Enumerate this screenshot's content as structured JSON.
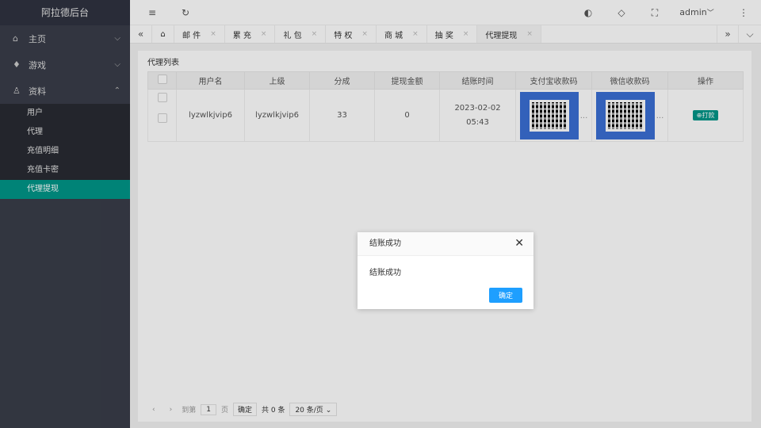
{
  "sidebar": {
    "title": "阿拉德后台",
    "menus": [
      {
        "icon": "⌂",
        "label": "主页",
        "chevron": "⌵"
      },
      {
        "icon": "♦",
        "label": "游戏",
        "chevron": "⌵"
      },
      {
        "icon": "♙",
        "label": "资料",
        "chevron": "⌃"
      }
    ],
    "sub_items": [
      "用户",
      "代理",
      "充值明细",
      "充值卡密",
      "代理提现"
    ]
  },
  "header": {
    "user": "admin",
    "menu_icon": "≡",
    "refresh_icon": "↻",
    "theme_icon": "◐",
    "tag_icon": "◇",
    "fullscreen_icon": "⛶",
    "more_icon": "⋮"
  },
  "tabs": {
    "left_arrow": "«",
    "right_arrow": "»",
    "dropdown": "⌵",
    "home_icon": "⌂",
    "items": [
      {
        "label": "邮 件"
      },
      {
        "label": "累 充"
      },
      {
        "label": "礼 包"
      },
      {
        "label": "特 权"
      },
      {
        "label": "商 城"
      },
      {
        "label": "抽 奖"
      },
      {
        "label": "代理提现"
      }
    ],
    "close": "×"
  },
  "panel": {
    "title": "代理列表",
    "columns": [
      "用户名",
      "上级",
      "分成",
      "提现金额",
      "结账时间",
      "支付宝收款码",
      "微信收款码",
      "操作"
    ],
    "rows": [
      {
        "username": "lyzwlkjvip6",
        "parent": "lyzwlkjvip6",
        "share": "33",
        "amount": "0",
        "date": "2023-02-02",
        "time": "05:43",
        "action": "打款",
        "action_icon": "⊕",
        "ellipsis": "..."
      }
    ]
  },
  "pager": {
    "prev": "‹",
    "next": "›",
    "goto": "到第",
    "page": "1",
    "page_unit": "页",
    "confirm": "确定",
    "total": "共 0 条",
    "per_page": "20 条/页"
  },
  "dialog": {
    "title": "结账成功",
    "message": "结账成功",
    "ok": "确定",
    "close": "✕"
  },
  "colors": {
    "accent": "#009688",
    "primary": "#1e9fff",
    "sidebar_bg": "#393d49"
  }
}
